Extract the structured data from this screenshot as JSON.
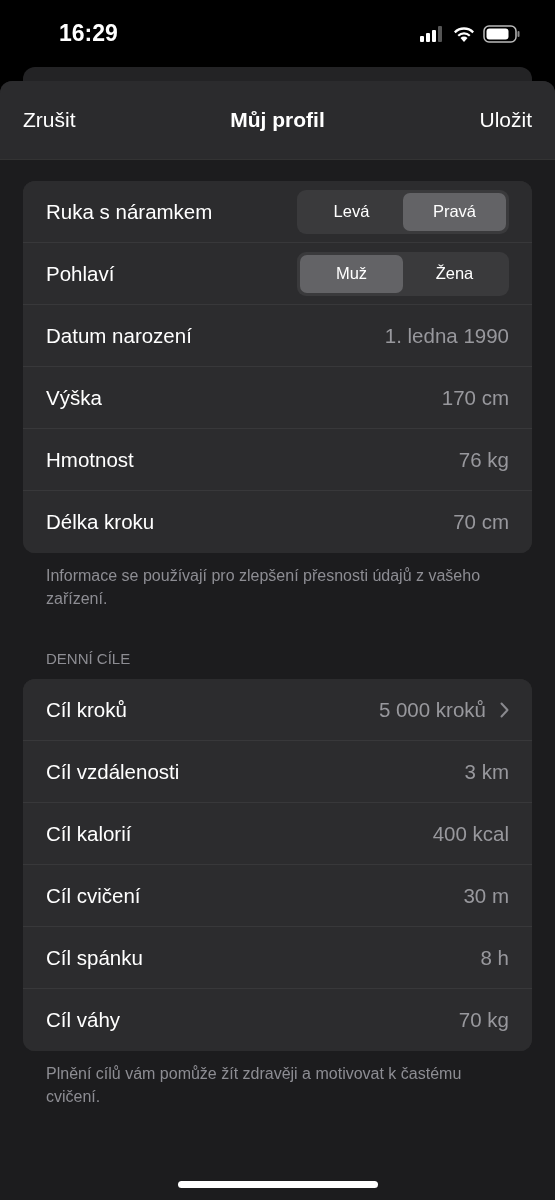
{
  "status_bar": {
    "time": "16:29"
  },
  "nav": {
    "cancel": "Zrušit",
    "title": "Můj profil",
    "save": "Uložit"
  },
  "sections": [
    {
      "rows": [
        {
          "kind": "segmented",
          "label": "Ruka s náramkem",
          "options": [
            {
              "label": "Levá",
              "selected": false
            },
            {
              "label": "Pravá",
              "selected": true
            }
          ]
        },
        {
          "kind": "segmented",
          "label": "Pohlaví",
          "options": [
            {
              "label": "Muž",
              "selected": true
            },
            {
              "label": "Žena",
              "selected": false
            }
          ]
        },
        {
          "kind": "value",
          "label": "Datum narození",
          "value": "1. ledna 1990",
          "chevron": false
        },
        {
          "kind": "value",
          "label": "Výška",
          "value": "170 cm",
          "chevron": false
        },
        {
          "kind": "value",
          "label": "Hmotnost",
          "value": "76 kg",
          "chevron": false
        },
        {
          "kind": "value",
          "label": "Délka kroku",
          "value": "70 cm",
          "chevron": false
        }
      ],
      "footer": "Informace se používají pro zlepšení přesnosti údajů z vašeho zařízení."
    },
    {
      "header": "DENNÍ CÍLE",
      "rows": [
        {
          "kind": "value",
          "label": "Cíl kroků",
          "value": "5 000 kroků",
          "chevron": true
        },
        {
          "kind": "value",
          "label": "Cíl vzdálenosti",
          "value": "3 km",
          "chevron": false
        },
        {
          "kind": "value",
          "label": "Cíl kalorií",
          "value": "400 kcal",
          "chevron": false
        },
        {
          "kind": "value",
          "label": "Cíl cvičení",
          "value": "30 m",
          "chevron": false
        },
        {
          "kind": "value",
          "label": "Cíl spánku",
          "value": "8 h",
          "chevron": false
        },
        {
          "kind": "value",
          "label": "Cíl váhy",
          "value": "70 kg",
          "chevron": false
        }
      ],
      "footer": "Plnění cílů vám pomůže žít zdravěji a motivovat k častému cvičení."
    }
  ]
}
